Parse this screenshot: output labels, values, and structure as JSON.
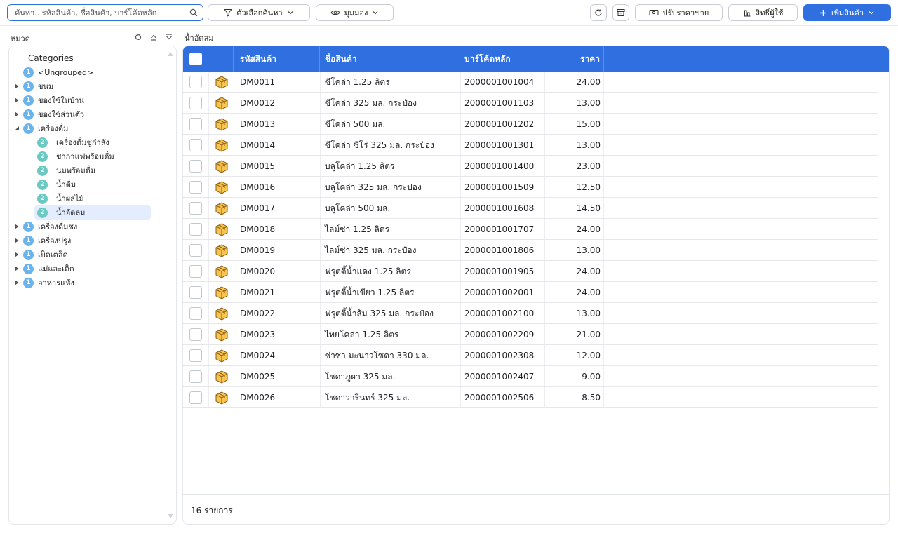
{
  "search": {
    "placeholder": "ค้นหา.. รหัสสินค้า, ชื่อสินค้า, บาร์โค้ดหลัก",
    "value": ""
  },
  "toolbar": {
    "filter_label": "ตัวเลือกค้นหา",
    "view_label": "มุมมอง",
    "adjust_price_label": "ปรับราคาขาย",
    "permission_label": "สิทธิ์ผู้ใช้",
    "add_product_label": "เพิ่มสินค้า"
  },
  "sidebar": {
    "title": "หมวด",
    "root_label": "Categories",
    "items": [
      {
        "level": "1",
        "label": "<Ungrouped>",
        "arrow": "none"
      },
      {
        "level": "1",
        "label": "ขนม",
        "arrow": "collapsed"
      },
      {
        "level": "1",
        "label": "ของใช้ในบ้าน",
        "arrow": "collapsed"
      },
      {
        "level": "1",
        "label": "ของใช้ส่วนตัว",
        "arrow": "collapsed"
      },
      {
        "level": "1",
        "label": "เครื่องดื่ม",
        "arrow": "expanded"
      },
      {
        "level": "2",
        "label": "เครื่องดื่มชูกำลัง",
        "arrow": "none"
      },
      {
        "level": "2",
        "label": "ชากาแฟพร้อมดื่ม",
        "arrow": "none"
      },
      {
        "level": "2",
        "label": "นมพร้อมดื่ม",
        "arrow": "none"
      },
      {
        "level": "2",
        "label": "น้ำดื่ม",
        "arrow": "none"
      },
      {
        "level": "2",
        "label": "น้ำผลไม้",
        "arrow": "none"
      },
      {
        "level": "2",
        "label": "น้ำอัดลม",
        "arrow": "none",
        "selected": true
      },
      {
        "level": "1",
        "label": "เครื่องดื่มชง",
        "arrow": "collapsed"
      },
      {
        "level": "1",
        "label": "เครื่องปรุง",
        "arrow": "collapsed"
      },
      {
        "level": "1",
        "label": "เบ็ดเตล็ด",
        "arrow": "collapsed"
      },
      {
        "level": "1",
        "label": "แม่และเด็ก",
        "arrow": "collapsed"
      },
      {
        "level": "1",
        "label": "อาหารแห้ง",
        "arrow": "collapsed"
      }
    ]
  },
  "breadcrumb": "น้ำอัดลม",
  "table": {
    "columns": {
      "code": "รหัสสินค้า",
      "name": "ชื่อสินค้า",
      "barcode": "บาร์โค้ดหลัก",
      "price": "ราคา"
    },
    "rows": [
      {
        "code": "DM0011",
        "name": "ซีโคล่า 1.25 ลิตร",
        "barcode": "2000001001004",
        "price": "24.00"
      },
      {
        "code": "DM0012",
        "name": "ซีโคล่า 325 มล. กระป๋อง",
        "barcode": "2000001001103",
        "price": "13.00"
      },
      {
        "code": "DM0013",
        "name": "ซีโคล่า 500 มล.",
        "barcode": "2000001001202",
        "price": "15.00"
      },
      {
        "code": "DM0014",
        "name": "ซีโคล่า ซีโร่ 325 มล. กระป๋อง",
        "barcode": "2000001001301",
        "price": "13.00"
      },
      {
        "code": "DM0015",
        "name": "บลูโคล่า 1.25 ลิตร",
        "barcode": "2000001001400",
        "price": "23.00"
      },
      {
        "code": "DM0016",
        "name": "บลูโคล่า 325 มล. กระป๋อง",
        "barcode": "2000001001509",
        "price": "12.50"
      },
      {
        "code": "DM0017",
        "name": "บลูโคล่า 500 มล.",
        "barcode": "2000001001608",
        "price": "14.50"
      },
      {
        "code": "DM0018",
        "name": "ไลม์ซ่า 1.25 ลิตร",
        "barcode": "2000001001707",
        "price": "24.00"
      },
      {
        "code": "DM0019",
        "name": "ไลม์ซ่า 325 มล. กระป๋อง",
        "barcode": "2000001001806",
        "price": "13.00"
      },
      {
        "code": "DM0020",
        "name": "ฟรุตตี้น้ำแดง 1.25 ลิตร",
        "barcode": "2000001001905",
        "price": "24.00"
      },
      {
        "code": "DM0021",
        "name": "ฟรุตตี้น้ำเขียว 1.25 ลิตร",
        "barcode": "2000001002001",
        "price": "24.00"
      },
      {
        "code": "DM0022",
        "name": "ฟรุตตี้น้ำส้ม 325 มล. กระป๋อง",
        "barcode": "2000001002100",
        "price": "13.00"
      },
      {
        "code": "DM0023",
        "name": "ไทยโคล่า 1.25 ลิตร",
        "barcode": "2000001002209",
        "price": "21.00"
      },
      {
        "code": "DM0024",
        "name": "ซ่าซ่า มะนาวโซดา 330 มล.",
        "barcode": "2000001002308",
        "price": "12.00"
      },
      {
        "code": "DM0025",
        "name": "โซดาภูผา 325 มล.",
        "barcode": "2000001002407",
        "price": "9.00"
      },
      {
        "code": "DM0026",
        "name": "โซดาวารินทร์ 325 มล.",
        "barcode": "2000001002506",
        "price": "8.50"
      }
    ],
    "row_icon": "box-icon"
  },
  "footer": {
    "count_label": "16 รายการ"
  },
  "colors": {
    "accent": "#2f6fdf",
    "badge_level1": "#6ab4ee",
    "badge_level2": "#6cc9c2",
    "selected_bg": "#e3edfd"
  }
}
